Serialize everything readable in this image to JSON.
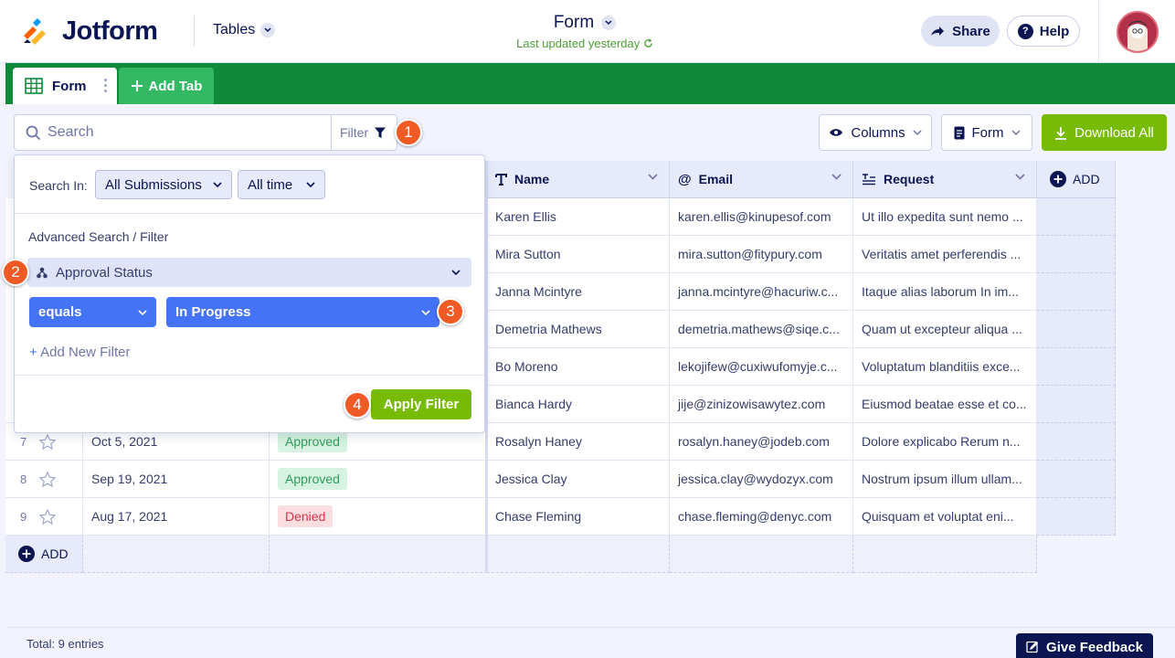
{
  "header": {
    "logo_text": "Jotform",
    "tables_label": "Tables",
    "form_title": "Form",
    "last_updated": "Last updated yesterday",
    "share_label": "Share",
    "help_label": "Help"
  },
  "tabs": {
    "active_label": "Form",
    "add_label": "Add Tab"
  },
  "toolbar": {
    "search_placeholder": "Search",
    "filter_label": "Filter",
    "columns_label": "Columns",
    "form_label": "Form",
    "download_label": "Download All"
  },
  "table": {
    "columns": [
      {
        "label": "Name",
        "icon": "text-T-icon"
      },
      {
        "label": "Email",
        "icon": "at-icon"
      },
      {
        "label": "Request",
        "icon": "long-text-icon"
      }
    ],
    "add_column_label": "ADD",
    "add_row_label": "ADD",
    "rows": [
      {
        "num": "",
        "date": "",
        "status": "",
        "name": "Karen Ellis",
        "email": "karen.ellis@kinupesof.com",
        "request": "Ut illo expedita sunt nemo ..."
      },
      {
        "num": "",
        "date": "",
        "status": "",
        "name": "Mira Sutton",
        "email": "mira.sutton@fitypury.com",
        "request": "Veritatis amet perferendis ..."
      },
      {
        "num": "",
        "date": "",
        "status": "",
        "name": "Janna Mcintyre",
        "email": "janna.mcintyre@hacuriw.c...",
        "request": "Itaque alias laborum In im..."
      },
      {
        "num": "",
        "date": "",
        "status": "",
        "name": "Demetria Mathews",
        "email": "demetria.mathews@siqe.c...",
        "request": "Quam ut excepteur aliqua ..."
      },
      {
        "num": "",
        "date": "",
        "status": "",
        "name": "Bo Moreno",
        "email": "lekojifew@cuxiwufomyje.c...",
        "request": "Voluptatum blanditiis exce..."
      },
      {
        "num": "",
        "date": "",
        "status": "",
        "name": "Bianca Hardy",
        "email": "jije@zinizowisawytez.com",
        "request": "Eiusmod beatae esse et co..."
      },
      {
        "num": "7",
        "date": "Oct 5, 2021",
        "status": "Approved",
        "name": "Rosalyn Haney",
        "email": "rosalyn.haney@jodeb.com",
        "request": "Dolore explicabo Rerum n..."
      },
      {
        "num": "8",
        "date": "Sep 19, 2021",
        "status": "Approved",
        "name": "Jessica Clay",
        "email": "jessica.clay@wydozyx.com",
        "request": "Nostrum ipsum illum ullam..."
      },
      {
        "num": "9",
        "date": "Aug 17, 2021",
        "status": "Denied",
        "name": "Chase Fleming",
        "email": "chase.fleming@denyc.com",
        "request": "Quisquam et voluptat eni..."
      }
    ]
  },
  "filter_popup": {
    "search_in_label": "Search In:",
    "submissions_value": "All Submissions",
    "time_value": "All time",
    "advanced_label": "Advanced Search / Filter",
    "field_label": "Approval Status",
    "operator_value": "equals",
    "value_value": "In Progress",
    "add_filter_plus": "+",
    "add_filter_label": "Add New Filter",
    "apply_label": "Apply Filter"
  },
  "badges": [
    "1",
    "2",
    "3",
    "4"
  ],
  "footer": {
    "total": "Total: 9 entries",
    "feedback_label": "Give Feedback"
  },
  "colors": {
    "brand_navy": "#0a1551",
    "tab_green": "#0f8a3a",
    "action_green": "#78bb07",
    "filter_blue": "#4573f8",
    "badge_orange": "#f05a24"
  }
}
